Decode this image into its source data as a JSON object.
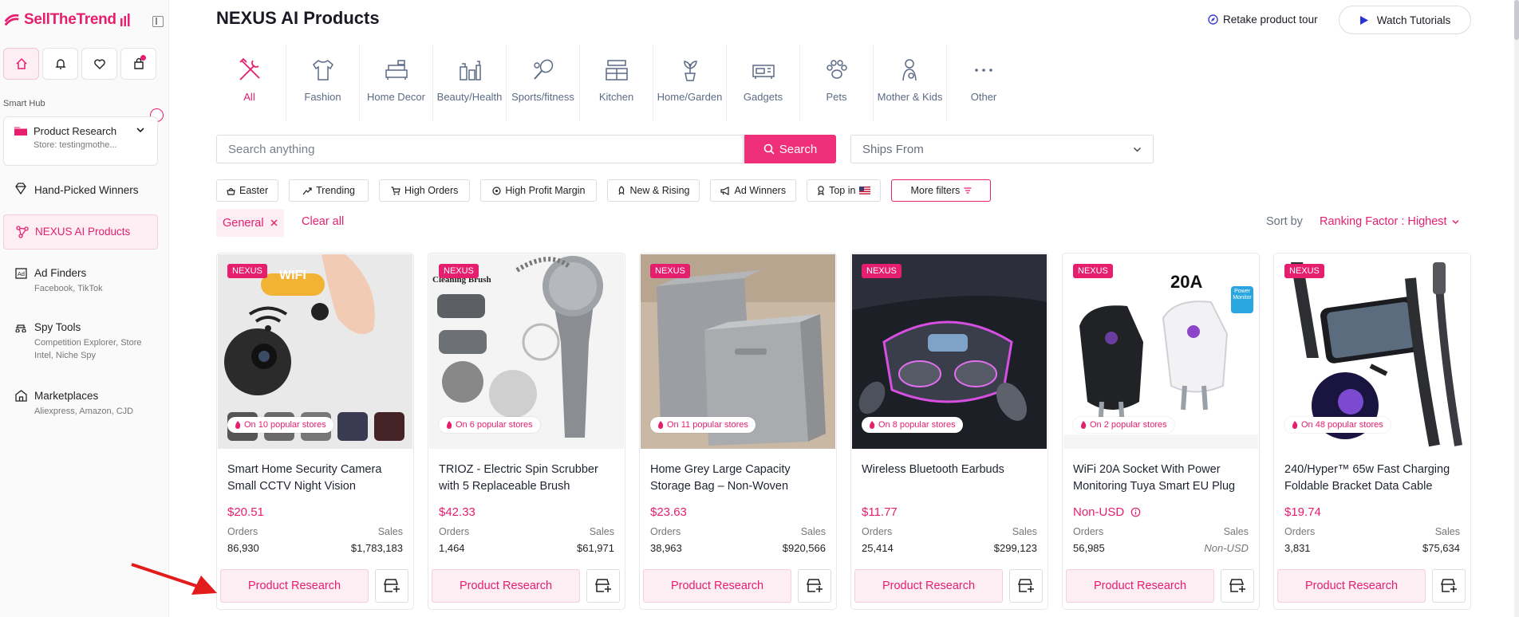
{
  "app": {
    "logo_text": "SellTheTrend"
  },
  "sidebar": {
    "quick_icons": [
      "home-icon",
      "bell-icon",
      "heart-icon",
      "bag-icon"
    ],
    "section_label": "Smart Hub",
    "product_research": {
      "title": "Product Research",
      "store": "Store: testingmothe..."
    },
    "items": [
      {
        "label": "Hand-Picked Winners",
        "sub": ""
      },
      {
        "label": "NEXUS AI Products",
        "sub": ""
      },
      {
        "label": "Ad Finders",
        "sub": "Facebook, TikTok"
      },
      {
        "label": "Spy Tools",
        "sub": "Competition Explorer, Store Intel, Niche Spy"
      },
      {
        "label": "Marketplaces",
        "sub": "Aliexpress, Amazon, CJD"
      }
    ]
  },
  "header": {
    "title": "NEXUS AI Products",
    "tour": "Retake product tour",
    "watch": "Watch Tutorials"
  },
  "categories": [
    {
      "label": "All",
      "icon": "tools-icon"
    },
    {
      "label": "Fashion",
      "icon": "shirt-icon"
    },
    {
      "label": "Home Decor",
      "icon": "sofa-icon"
    },
    {
      "label": "Beauty/Health",
      "icon": "bottles-icon"
    },
    {
      "label": "Sports/fitness",
      "icon": "racket-icon"
    },
    {
      "label": "Kitchen",
      "icon": "kitchen-icon"
    },
    {
      "label": "Home/Garden",
      "icon": "plant-icon"
    },
    {
      "label": "Gadgets",
      "icon": "gadget-icon"
    },
    {
      "label": "Pets",
      "icon": "paw-icon"
    },
    {
      "label": "Mother & Kids",
      "icon": "mother-icon"
    },
    {
      "label": "Other",
      "icon": "dots-icon"
    }
  ],
  "search": {
    "placeholder": "Search anything",
    "button": "Search",
    "ships_from": "Ships From"
  },
  "filters": [
    "Easter",
    "Trending",
    "High Orders",
    "High Profit Margin",
    "New & Rising",
    "Ad Winners",
    "Top in",
    "More filters"
  ],
  "active_filter": "General",
  "clear_all": "Clear all",
  "sort": {
    "label": "Sort by",
    "value": "Ranking Factor : Highest"
  },
  "product_labels": {
    "badge": "NEXUS",
    "orders": "Orders",
    "sales": "Sales",
    "button": "Product Research"
  },
  "products": [
    {
      "title": "Smart Home Security Camera Small CCTV Night Vision",
      "price": "$20.51",
      "orders": "86,930",
      "sales": "$1,783,183",
      "stores": "On 10 popular stores",
      "banner": "WIFI",
      "banner2": ""
    },
    {
      "title": "TRIOZ - Electric Spin Scrubber with 5 Replaceable Brush",
      "price": "$42.33",
      "orders": "1,464",
      "sales": "$61,971",
      "stores": "On 6 popular stores",
      "banner": "Cleaning Brush",
      "banner2": ""
    },
    {
      "title": "Home Grey Large Capacity Storage Bag – Non-Woven",
      "price": "$23.63",
      "orders": "38,963",
      "sales": "$920,566",
      "stores": "On 11 popular stores",
      "banner": "",
      "banner2": ""
    },
    {
      "title": "Wireless Bluetooth Earbuds",
      "price": "$11.77",
      "orders": "25,414",
      "sales": "$299,123",
      "stores": "On 8 popular stores",
      "banner": "",
      "banner2": ""
    },
    {
      "title": "WiFi 20A Socket With Power Monitoring Tuya Smart EU Plug",
      "price": "Non-USD",
      "orders": "56,985",
      "sales": "Non-USD",
      "stores": "On 2 popular stores",
      "banner": "20A",
      "banner2": "Power Monitor"
    },
    {
      "title": "240/Hyper™ 65w Fast Charging Foldable Bracket Data Cable",
      "price": "$19.74",
      "orders": "3,831",
      "sales": "$75,634",
      "stores": "On 48 popular stores",
      "banner": "",
      "banner2": ""
    }
  ],
  "colors": {
    "accent": "#e51e6e",
    "accent_soft": "#fdeef4",
    "muted": "#5c6a86"
  }
}
